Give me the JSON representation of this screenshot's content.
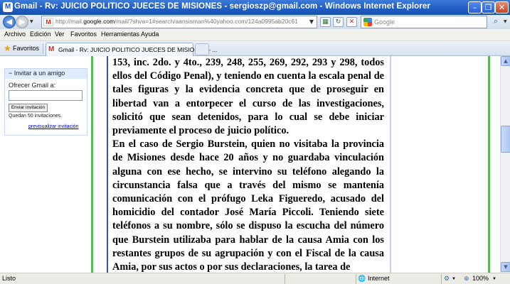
{
  "window": {
    "title": "Gmail - Rv: JUICIO POLITICO JUECES DE MISIONES - sergioszp@gmail.com - Windows Internet Explorer",
    "favicon": "M"
  },
  "address_bar": {
    "url_prefix": "http://mail.",
    "url_domain": "google.com",
    "url_rest": "/mail/?shva=1#search/aansisman%40yahoo.com/124a0995ab20c619"
  },
  "search": {
    "placeholder": "Google"
  },
  "menu": [
    "Archivo",
    "Edición",
    "Ver",
    "Favoritos",
    "Herramientas",
    "Ayuda"
  ],
  "favorites_bar": {
    "label": "Favoritos",
    "tab_title": "Gmail - Rv: JUICIO POLITICO JUECES DE MISIONES - ..."
  },
  "invite_panel": {
    "title": "Invitar a un amigo",
    "label": "Ofrecer Gmail a:",
    "button": "Enviar invitación",
    "remaining": "Quedan 50 invitaciones.",
    "preview_link": "previsualizar invitación"
  },
  "document": {
    "paragraph1": "153, inc. 2do. y 4to., 239, 248, 255, 269, 292, 293 y 298, todos ellos del Código Penal), y teniendo en cuenta la escala penal de tales figuras y la evidencia concreta que de proseguir en libertad van a entorpecer el curso de las investigaciones, solicitó que sean detenidos, para lo cual se debe iniciar previamente el proceso de juicio político.",
    "paragraph2": "En el caso de Sergio Burstein, quien no visitaba la provincia de Misiones desde hace 20 años y no guardaba vinculación alguna con ese hecho, se intervino su teléfono alegando la circunstancia falsa que a través del mismo se mantenía comunicación con el prófugo Leka Figueredo, acusado del homicidio del contador José María Piccoli. Teniendo siete teléfonos a su nombre, sólo se dispuso la escucha del número que Burstein utilizaba para hablar de la causa Amia con los restantes grupos de su agrupación y con el Fiscal de la causa Amia, por sus actos o por sus declaraciones, la tarea de"
  },
  "status_bar": {
    "left": "Listo",
    "zone": "Internet",
    "zoom": "100%"
  },
  "colors": {
    "titlebar": "#1f5ec3",
    "content_border_green": "#5cb85c",
    "content_border_blue": "#3b4fb8"
  }
}
